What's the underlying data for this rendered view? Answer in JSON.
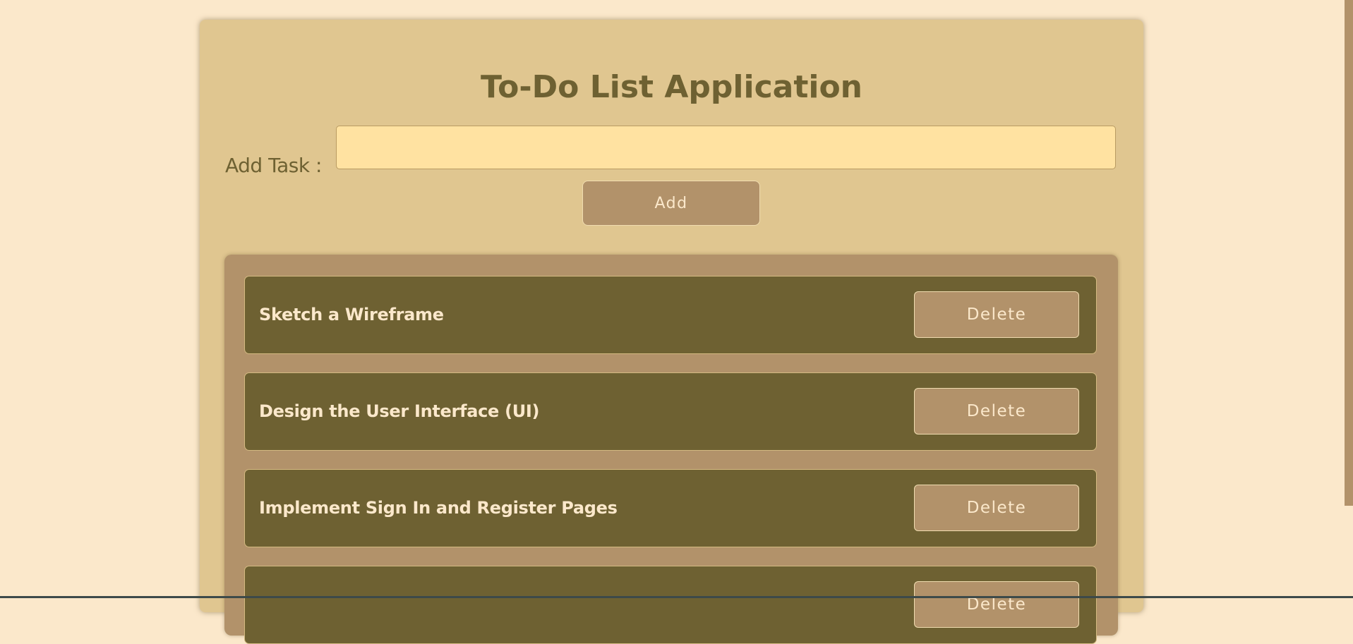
{
  "app": {
    "title": "To-Do List Application"
  },
  "form": {
    "label": "Add Task :",
    "input_value": "",
    "input_placeholder": "",
    "add_label": "Add"
  },
  "tasks": [
    {
      "text": "Sketch a Wireframe",
      "delete_label": "Delete"
    },
    {
      "text": "Design the User Interface (UI)",
      "delete_label": "Delete"
    },
    {
      "text": "Implement Sign In and Register Pages",
      "delete_label": "Delete"
    },
    {
      "text": "",
      "delete_label": "Delete"
    }
  ],
  "colors": {
    "page_background": "#fbe8cb",
    "card_background": "#e0c690",
    "heading_text": "#6e6132",
    "input_background": "#ffe2a1",
    "button_background": "#b2926a",
    "task_background": "#6e6132",
    "task_text": "#fbe8cb"
  }
}
